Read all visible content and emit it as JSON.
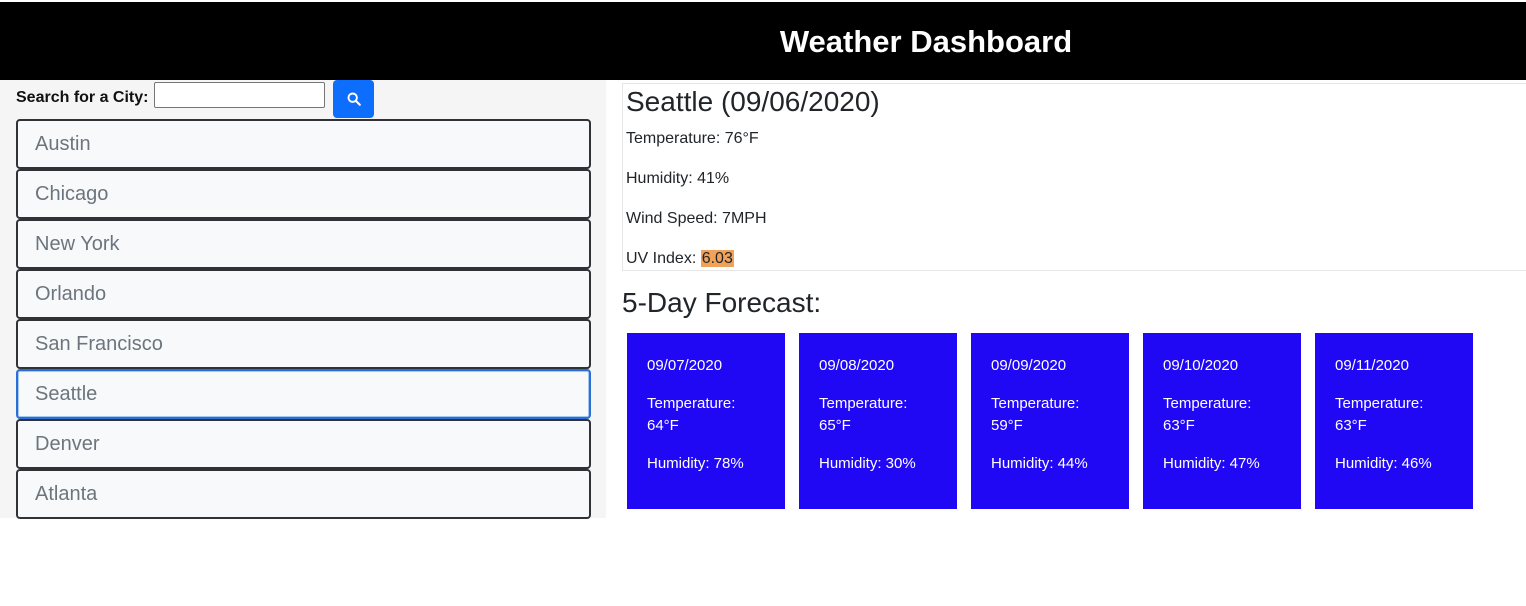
{
  "header": {
    "title": "Weather Dashboard"
  },
  "search": {
    "label": "Search for a City:",
    "value": "",
    "placeholder": "",
    "button_icon": "search-icon"
  },
  "cities": [
    {
      "name": "Austin",
      "active": false
    },
    {
      "name": "Chicago",
      "active": false
    },
    {
      "name": "New York",
      "active": false
    },
    {
      "name": "Orlando",
      "active": false
    },
    {
      "name": "San Francisco",
      "active": false
    },
    {
      "name": "Seattle",
      "active": true
    },
    {
      "name": "Denver",
      "active": false
    },
    {
      "name": "Atlanta",
      "active": false
    }
  ],
  "current": {
    "title": "Seattle (09/06/2020)",
    "temperature": "Temperature: 76°F",
    "humidity": "Humidity: 41%",
    "wind": "Wind Speed: 7MPH",
    "uv_label": "UV Index: ",
    "uv_value": "6.03",
    "uv_color": "#f0a25a"
  },
  "forecast": {
    "heading": "5-Day Forecast:",
    "card_color": "#2008f5",
    "days": [
      {
        "date": "09/07/2020",
        "temp_label": "Temperature:",
        "temp": "64°F",
        "humidity": "Humidity: 78%"
      },
      {
        "date": "09/08/2020",
        "temp_label": "Temperature:",
        "temp": "65°F",
        "humidity": "Humidity: 30%"
      },
      {
        "date": "09/09/2020",
        "temp_label": "Temperature:",
        "temp": "59°F",
        "humidity": "Humidity: 44%"
      },
      {
        "date": "09/10/2020",
        "temp_label": "Temperature:",
        "temp": "63°F",
        "humidity": "Humidity: 47%"
      },
      {
        "date": "09/11/2020",
        "temp_label": "Temperature:",
        "temp": "63°F",
        "humidity": "Humidity: 46%"
      }
    ]
  }
}
